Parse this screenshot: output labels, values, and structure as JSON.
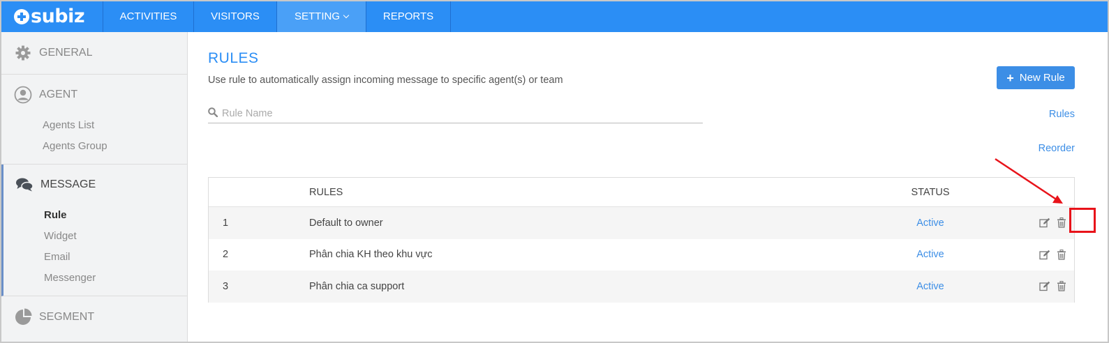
{
  "brand": {
    "logo_text": "subiz"
  },
  "nav": {
    "items": [
      {
        "label": "ACTIVITIES"
      },
      {
        "label": "VISITORS"
      },
      {
        "label": "SETTING"
      },
      {
        "label": "REPORTS"
      }
    ],
    "active": "SETTING"
  },
  "sidebar": {
    "general": {
      "label": "GENERAL",
      "icon": "gear-icon"
    },
    "agent": {
      "label": "AGENT",
      "icon": "user-icon",
      "links": [
        "Agents List",
        "Agents Group"
      ]
    },
    "message": {
      "label": "MESSAGE",
      "icon": "chat-icon",
      "links": [
        "Rule",
        "Widget",
        "Email",
        "Messenger"
      ],
      "current": "Rule"
    },
    "segment": {
      "label": "SEGMENT",
      "icon": "pie-chart-icon"
    }
  },
  "main": {
    "title": "RULES",
    "description": "Use rule to automatically assign incoming message to specific agent(s) or team",
    "new_button": "New Rule",
    "search_placeholder": "Rule Name",
    "rules_link": "Rules",
    "reorder_link": "Reorder",
    "table": {
      "headers": {
        "num": "",
        "rules": "RULES",
        "status": "STATUS",
        "actions": ""
      },
      "rows": [
        {
          "num": "1",
          "name": "Default to owner",
          "status": "Active"
        },
        {
          "num": "2",
          "name": "Phân chia KH theo khu vực",
          "status": "Active"
        },
        {
          "num": "3",
          "name": "Phân chia ca support",
          "status": "Active"
        }
      ]
    }
  },
  "colors": {
    "topbar": "#2b8ef5",
    "accent": "#3c8ee6",
    "annotation": "#e8131a"
  }
}
